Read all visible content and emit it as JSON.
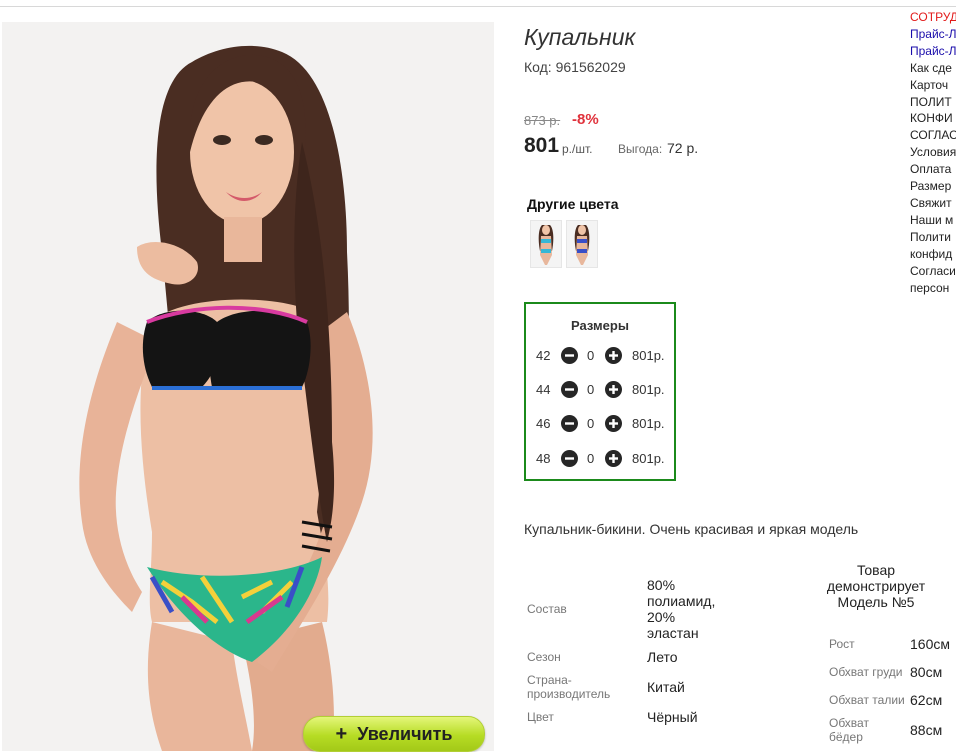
{
  "product": {
    "title": "Купальник",
    "code": "Код: 961562029",
    "old_price": "873 р.",
    "discount": "-8%",
    "price": "801",
    "price_unit": "р./шт.",
    "benefit_label": "Выгода:",
    "benefit_value": "72 р.",
    "zoom_label": "Увеличить",
    "zoom_plus": "+"
  },
  "other_colors": {
    "label": "Другие цвета",
    "swatches": [
      "#36b7d6",
      "#3a4fc7"
    ]
  },
  "sizes": {
    "title": "Размеры",
    "rows": [
      {
        "size": "42",
        "qty": "0",
        "price": "801р."
      },
      {
        "size": "44",
        "qty": "0",
        "price": "801р."
      },
      {
        "size": "46",
        "qty": "0",
        "price": "801р."
      },
      {
        "size": "48",
        "qty": "0",
        "price": "801р."
      }
    ]
  },
  "description": "Купальник-бикини. Очень красивая и яркая модель",
  "specs": [
    {
      "label": "Состав",
      "value": [
        "80%",
        "полиамид,",
        "20%",
        "эластан"
      ]
    },
    {
      "label": "Сезон",
      "value": [
        "Лето"
      ]
    },
    {
      "label": [
        "Страна-",
        "производитель"
      ],
      "value": [
        "Китай"
      ]
    },
    {
      "label": "Цвет",
      "value": [
        "Чёрный"
      ]
    }
  ],
  "model": {
    "heading": [
      "Товар",
      "демонстрирует",
      "Модель №5"
    ],
    "measurements": [
      {
        "label": "Рост",
        "value": "160см"
      },
      {
        "label": "Обхват груди",
        "value": "80см"
      },
      {
        "label": "Обхват талии",
        "value": "62см"
      },
      {
        "label": [
          "Обхват",
          "бёдер"
        ],
        "value": "88см"
      }
    ]
  },
  "side_menu": [
    "СОТРУД",
    "Прайс-Л",
    "Прайс-Л",
    "Как сде",
    "Карточ",
    "ПОЛИТ",
    "КОНФИ",
    "СОГЛАС",
    "Условия",
    "Оплата",
    "Размер",
    "Свяжит",
    "Наши м",
    "Полити",
    "конфид",
    "Согласи",
    "персон"
  ],
  "colors": {
    "sizes_border": "#1b8a1b",
    "discount": "#e0323c",
    "zoom_button": "#b6dc24",
    "menu_red": "#e21a1a",
    "menu_blue": "#1a0dab"
  }
}
